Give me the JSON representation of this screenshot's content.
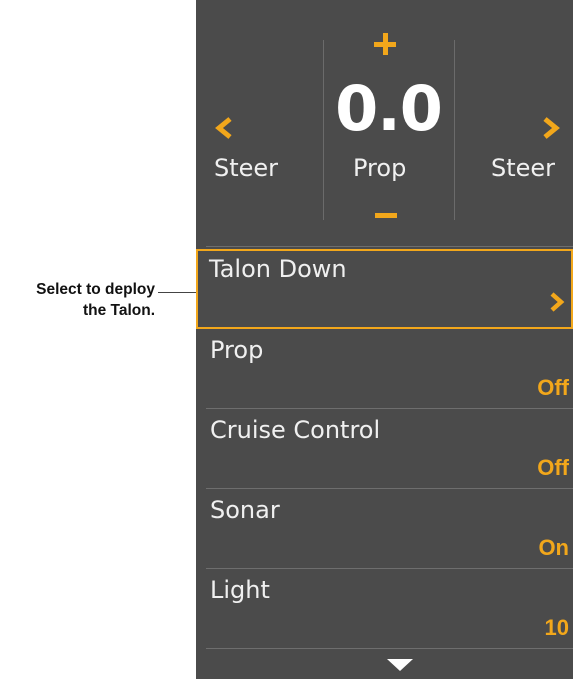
{
  "callout": {
    "line1": "Select to deploy",
    "line2": "the Talon."
  },
  "control": {
    "speed_value": "0.0",
    "steer_left_label": "Steer",
    "prop_label": "Prop",
    "steer_right_label": "Steer",
    "icons": [
      "plus-icon",
      "minus-icon",
      "chevron-left-icon",
      "chevron-right-icon"
    ]
  },
  "menu": {
    "items": [
      {
        "label": "Talon Down",
        "value": "",
        "selected": true,
        "icon": "chevron-right-icon"
      },
      {
        "label": "Prop",
        "value": "Off"
      },
      {
        "label": "Cruise Control",
        "value": "Off"
      },
      {
        "label": "Sonar",
        "value": "On"
      },
      {
        "label": "Light",
        "value": "10"
      }
    ],
    "scroll_icon": "caret-down-icon"
  },
  "colors": {
    "panel_bg": "#4b4b4b",
    "accent": "#f2a71b",
    "text": "#f0f0f0"
  }
}
